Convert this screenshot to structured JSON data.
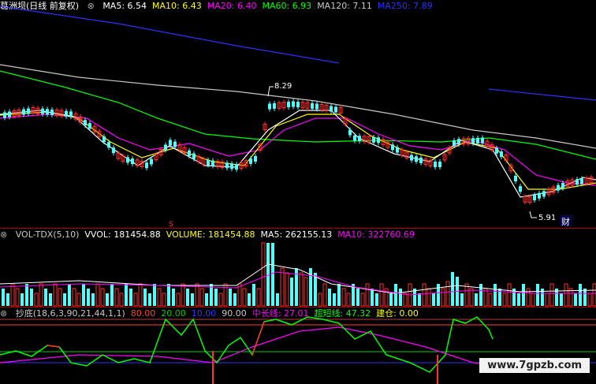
{
  "main_header": {
    "stock": "葛洲坝(日线 前复权)",
    "indicators": [
      {
        "label": "MA5: 6.54",
        "color": "#ffffff"
      },
      {
        "label": "MA10: 6.43",
        "color": "#ffff00"
      },
      {
        "label": "MA20: 6.40",
        "color": "#ff00ff"
      },
      {
        "label": "MA60: 6.93",
        "color": "#00ff00"
      },
      {
        "label": "MA120: 7.11",
        "color": "#c8c8c8"
      },
      {
        "label": "MA250: 7.89",
        "color": "#3030ff"
      }
    ]
  },
  "price_annotations": {
    "high": "8.29",
    "low": "5.91",
    "marker_s": "S",
    "marker_cai": "财"
  },
  "volume_header": {
    "items": [
      {
        "label": "VOL-TDX(5,10)",
        "color": "#c8c8c8"
      },
      {
        "label": "VVOL: 181454.88",
        "color": "#ffffff"
      },
      {
        "label": "VOLUME: 181454.88",
        "color": "#ffff00"
      },
      {
        "label": "MA5: 262155.13",
        "color": "#ffffff"
      },
      {
        "label": "MA10: 322760.69",
        "color": "#ff00ff"
      }
    ]
  },
  "osc_header": {
    "items": [
      {
        "label": "抄底(18,6,3,90,21,44,1,1)",
        "color": "#c8c8c8"
      },
      {
        "label": "80.00",
        "color": "#ff4040"
      },
      {
        "label": "20.00",
        "color": "#00cc00"
      },
      {
        "label": "10.00",
        "color": "#3030ff"
      },
      {
        "label": "90.00",
        "color": "#c8c8c8"
      },
      {
        "label": "中长线: 27.01",
        "color": "#ff00ff"
      },
      {
        "label": "超短线: 47.32",
        "color": "#00ff00"
      },
      {
        "label": "建仓: 0.00",
        "color": "#ffff00"
      }
    ]
  },
  "watermark": "www.7gpzb.com",
  "colors": {
    "up": "#ff3030",
    "down": "#54fcfc",
    "ma250": "#3030ff",
    "ma120": "#c8c8c8",
    "ma60": "#00ff00",
    "ma20": "#ff00ff",
    "ma10": "#ffff00",
    "ma5": "#ffffff",
    "frame": "#b00000"
  }
}
